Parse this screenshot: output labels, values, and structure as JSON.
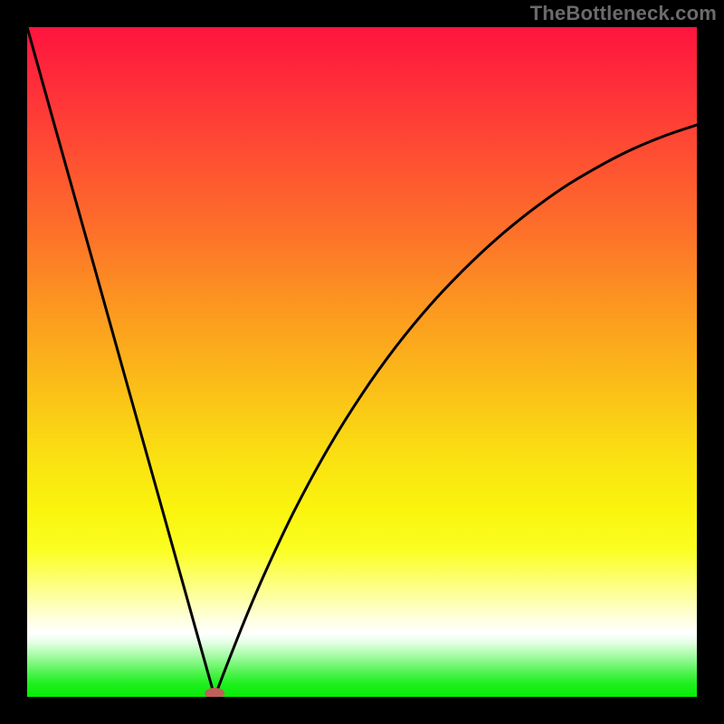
{
  "watermark": "TheBottleneck.com",
  "colors": {
    "background": "#000000",
    "gradient_top": "#fe143e",
    "gradient_bottom": "#06ed06",
    "curve": "#000000",
    "blob": "#c06058"
  },
  "chart_data": {
    "type": "line",
    "title": "",
    "xlabel": "",
    "ylabel": "",
    "xlim": [
      0,
      1
    ],
    "ylim": [
      0,
      1
    ],
    "notes": "V-shaped bottleneck curve. y is mismatch magnitude (0 = optimal/green, 1 = worst/red). Minimum near x≈0.28. Left branch is steep/near-linear; right branch rises with diminishing slope (concave).",
    "curve_points": [
      {
        "x": 0.0,
        "y": 1.0
      },
      {
        "x": 0.05,
        "y": 0.821
      },
      {
        "x": 0.1,
        "y": 0.643
      },
      {
        "x": 0.15,
        "y": 0.464
      },
      {
        "x": 0.2,
        "y": 0.286
      },
      {
        "x": 0.25,
        "y": 0.107
      },
      {
        "x": 0.28,
        "y": 0.0
      },
      {
        "x": 0.3,
        "y": 0.052
      },
      {
        "x": 0.33,
        "y": 0.127
      },
      {
        "x": 0.36,
        "y": 0.196
      },
      {
        "x": 0.4,
        "y": 0.28
      },
      {
        "x": 0.45,
        "y": 0.372
      },
      {
        "x": 0.5,
        "y": 0.452
      },
      {
        "x": 0.55,
        "y": 0.522
      },
      {
        "x": 0.6,
        "y": 0.583
      },
      {
        "x": 0.65,
        "y": 0.636
      },
      {
        "x": 0.7,
        "y": 0.683
      },
      {
        "x": 0.75,
        "y": 0.724
      },
      {
        "x": 0.8,
        "y": 0.76
      },
      {
        "x": 0.85,
        "y": 0.79
      },
      {
        "x": 0.9,
        "y": 0.816
      },
      {
        "x": 0.95,
        "y": 0.837
      },
      {
        "x": 1.0,
        "y": 0.854
      }
    ],
    "minimum_marker": {
      "x": 0.28,
      "y": 0.0
    }
  }
}
